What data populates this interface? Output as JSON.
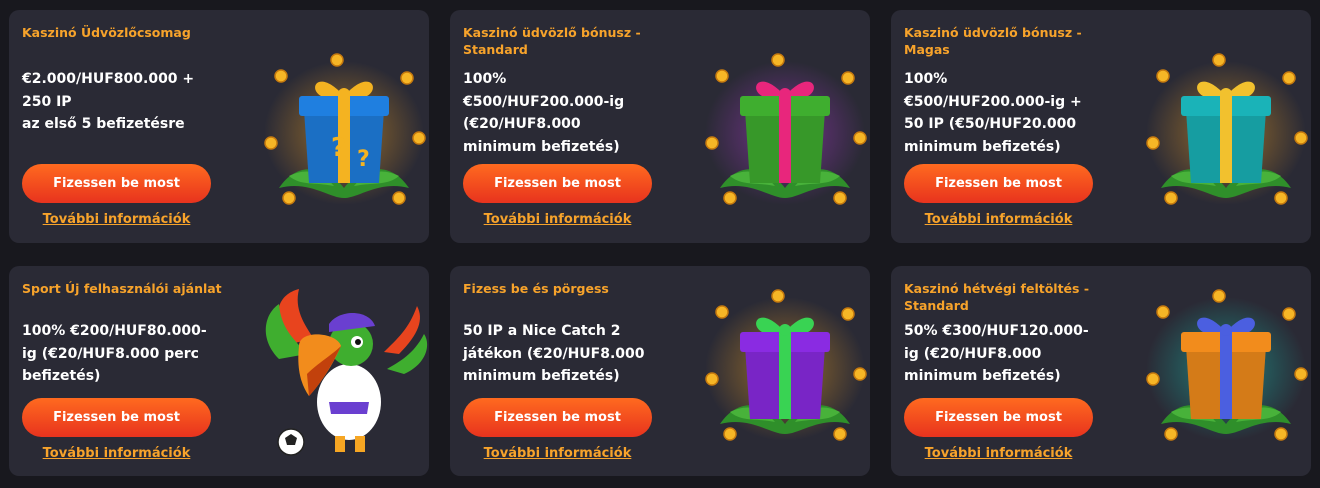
{
  "cards": [
    {
      "title": "Kaszinó Üdvözlőcsomag",
      "description": "€2.000/HUF800.000 +\n250 IP\naz első 5 befizetésre",
      "button": "Fizessen be most",
      "link": "További információk",
      "image": "gift-box-blue-question-icon",
      "colors": {
        "box": "#1f7fe0",
        "ribbon": "#f4b321",
        "glow": "#f6a623"
      }
    },
    {
      "title": "Kaszinó üdvözlő bónusz - Standard",
      "description": "100%\n€500/HUF200.000-ig\n(€20/HUF8.000\nminimum befizetés)",
      "button": "Fizessen be most",
      "link": "További információk",
      "image": "gift-box-green-icon",
      "colors": {
        "box": "#3fae2f",
        "ribbon": "#e8267c",
        "glow": "#b43cd7"
      }
    },
    {
      "title": "Kaszinó üdvözlő bónusz - Magas",
      "description": "100%\n€500/HUF200.000-ig +\n50 IP (€50/HUF20.000\nminimum befizetés)",
      "button": "Fizessen be most",
      "link": "További információk",
      "image": "gift-box-teal-icon",
      "colors": {
        "box": "#1ab3b8",
        "ribbon": "#f2c12e",
        "glow": "#f6a623"
      }
    },
    {
      "title": "Sport Új felhasználói ajánlat",
      "description": "100% €200/HUF80.000-\nig (€20/HUF8.000 perc\nbefizetés)",
      "button": "Fizessen be most",
      "link": "További információk",
      "image": "toucan-football-mascot-icon",
      "colors": {
        "box": "#f28c1c",
        "ribbon": "#6a3fd0",
        "glow": "#3fae2f"
      }
    },
    {
      "title": "Fizess be és pörgess",
      "description": "50 IP a Nice Catch 2\njátékon (€20/HUF8.000\nminimum befizetés)",
      "button": "Fizessen be most",
      "link": "További információk",
      "image": "gift-box-purple-icon",
      "colors": {
        "box": "#8a2be2",
        "ribbon": "#39d353",
        "glow": "#f6a623"
      }
    },
    {
      "title": "Kaszinó hétvégi feltöltés - Standard",
      "description": "50% €300/HUF120.000-\nig (€20/HUF8.000\nminimum befizetés)",
      "button": "Fizessen be most",
      "link": "További információk",
      "image": "gift-box-orange-icon",
      "colors": {
        "box": "#f28c1c",
        "ribbon": "#4b5fe0",
        "glow": "#17c9b5"
      }
    }
  ]
}
